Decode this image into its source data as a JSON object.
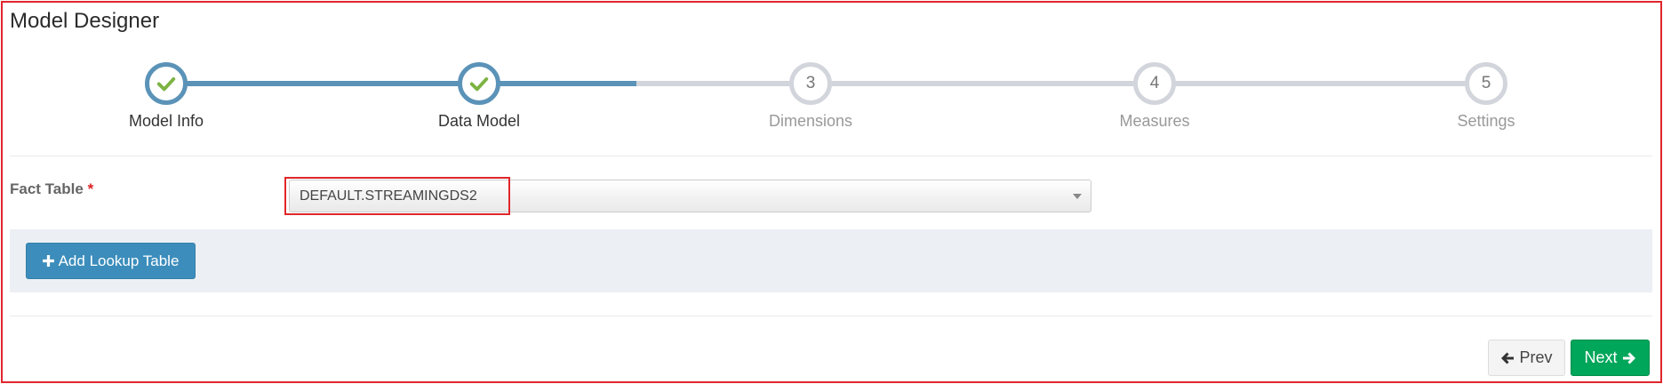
{
  "page": {
    "title": "Model Designer"
  },
  "wizard": {
    "steps": [
      {
        "label": "Model Info",
        "number": "1",
        "status": "complete",
        "icon": "check-icon"
      },
      {
        "label": "Data Model",
        "number": "2",
        "status": "complete",
        "icon": "check-icon"
      },
      {
        "label": "Dimensions",
        "number": "3",
        "status": "pending"
      },
      {
        "label": "Measures",
        "number": "4",
        "status": "pending"
      },
      {
        "label": "Settings",
        "number": "5",
        "status": "pending"
      }
    ]
  },
  "fact_table": {
    "label": "Fact Table",
    "required_marker": "*",
    "selected_value": "DEFAULT.STREAMINGDS2"
  },
  "lookup": {
    "add_button_label": "Add Lookup Table",
    "icon": "plus-icon"
  },
  "footer": {
    "prev_label": "Prev",
    "prev_icon": "arrow-left-icon",
    "next_label": "Next",
    "next_icon": "arrow-right-icon"
  },
  "colors": {
    "step_complete": "#5b93b8",
    "step_pending": "#d2d5db",
    "check": "#7cb342",
    "primary_button": "#3c8dbc",
    "success_button": "#00a65a",
    "highlight": "#e0262b",
    "required": "#dd2222"
  }
}
